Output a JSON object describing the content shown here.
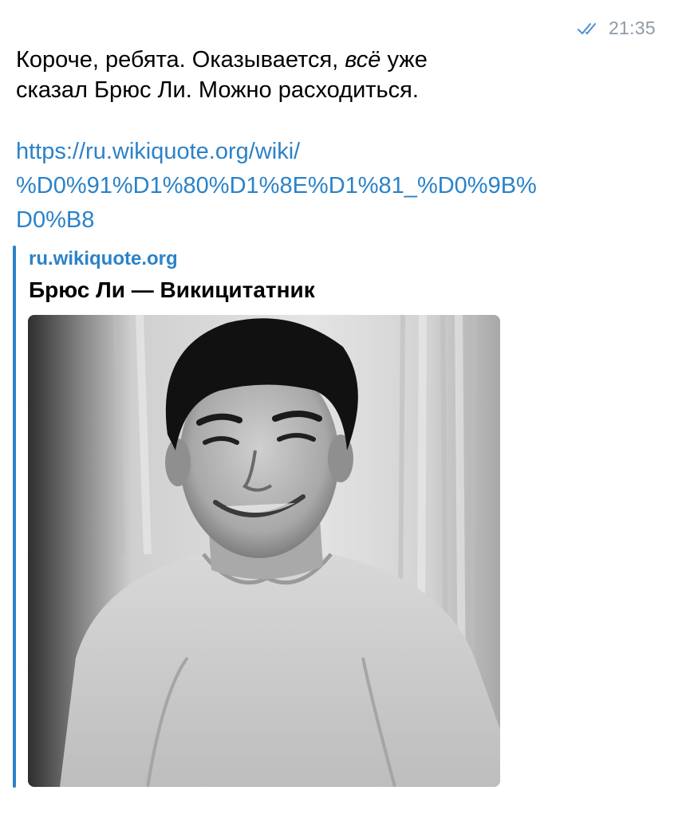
{
  "message": {
    "time": "21:35",
    "status_icon": "double-check-icon",
    "text": {
      "line1_start": "Короче, ребята. Оказывается, ",
      "line1_italic": "всё",
      "line1_end": " уже",
      "line2": "сказал Брюс Ли. Можно расходиться."
    },
    "link": {
      "line1": "https://ru.wikiquote.org/wiki/",
      "line2": "%D0%91%D1%80%D1%8E%D1%81_%D0%9B%",
      "line3": "D0%B8"
    },
    "preview": {
      "site": "ru.wikiquote.org",
      "title": "Брюс Ли — Викицитатник",
      "image": "black-and-white portrait photo of Bruce Lee smiling"
    }
  },
  "colors": {
    "link": "#2b82c8",
    "time": "#8e9aa6",
    "check": "#4a8fd6",
    "text": "#000000"
  }
}
